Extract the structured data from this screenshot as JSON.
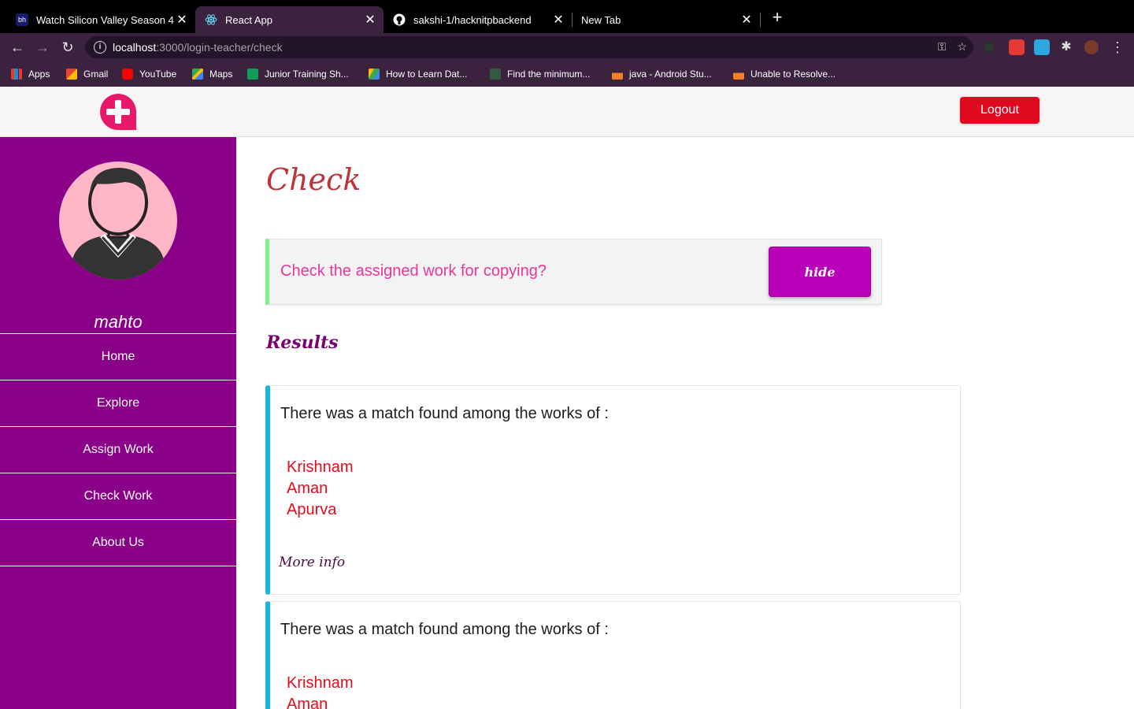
{
  "browser": {
    "tabs": [
      {
        "title": "Watch Silicon Valley Season 4",
        "favicon": "bh"
      },
      {
        "title": "React App",
        "favicon": "react-icon"
      },
      {
        "title": "sakshi-1/hacknitpbackend",
        "favicon": "github-icon"
      },
      {
        "title": "New Tab",
        "favicon": ""
      }
    ],
    "new_tab": "+",
    "address": {
      "host": "localhost",
      "path": ":3000/login-teacher/check"
    },
    "bookmarks": [
      "Apps",
      "Gmail",
      "YouTube",
      "Maps",
      "Junior Training Sh...",
      "How to Learn Dat...",
      "Find the minimum...",
      "java - Android Stu...",
      "Unable to Resolve..."
    ]
  },
  "header": {
    "logout_label": "Logout"
  },
  "sidebar": {
    "username": "mahto",
    "items": [
      {
        "label": "Home"
      },
      {
        "label": "Explore"
      },
      {
        "label": "Assign Work"
      },
      {
        "label": "Check Work"
      },
      {
        "label": "About Us"
      }
    ]
  },
  "main": {
    "title": "Check",
    "question": "Check the assigned work for copying?",
    "hide_label": "hide",
    "results_title": "Results",
    "results": [
      {
        "text": "There was a match found among the works of :",
        "names": [
          "Krishnam",
          "Aman",
          "Apurva"
        ],
        "more": "More info"
      },
      {
        "text": "There was a match found among the works of :",
        "names": [
          "Krishnam",
          "Aman"
        ]
      }
    ]
  },
  "colors": {
    "sidebar": "#8b0088",
    "logout": "#e0081e",
    "hide_button": "#bb00bb",
    "accent_pink": "#e8196b",
    "card_border": "#14b5e8"
  }
}
